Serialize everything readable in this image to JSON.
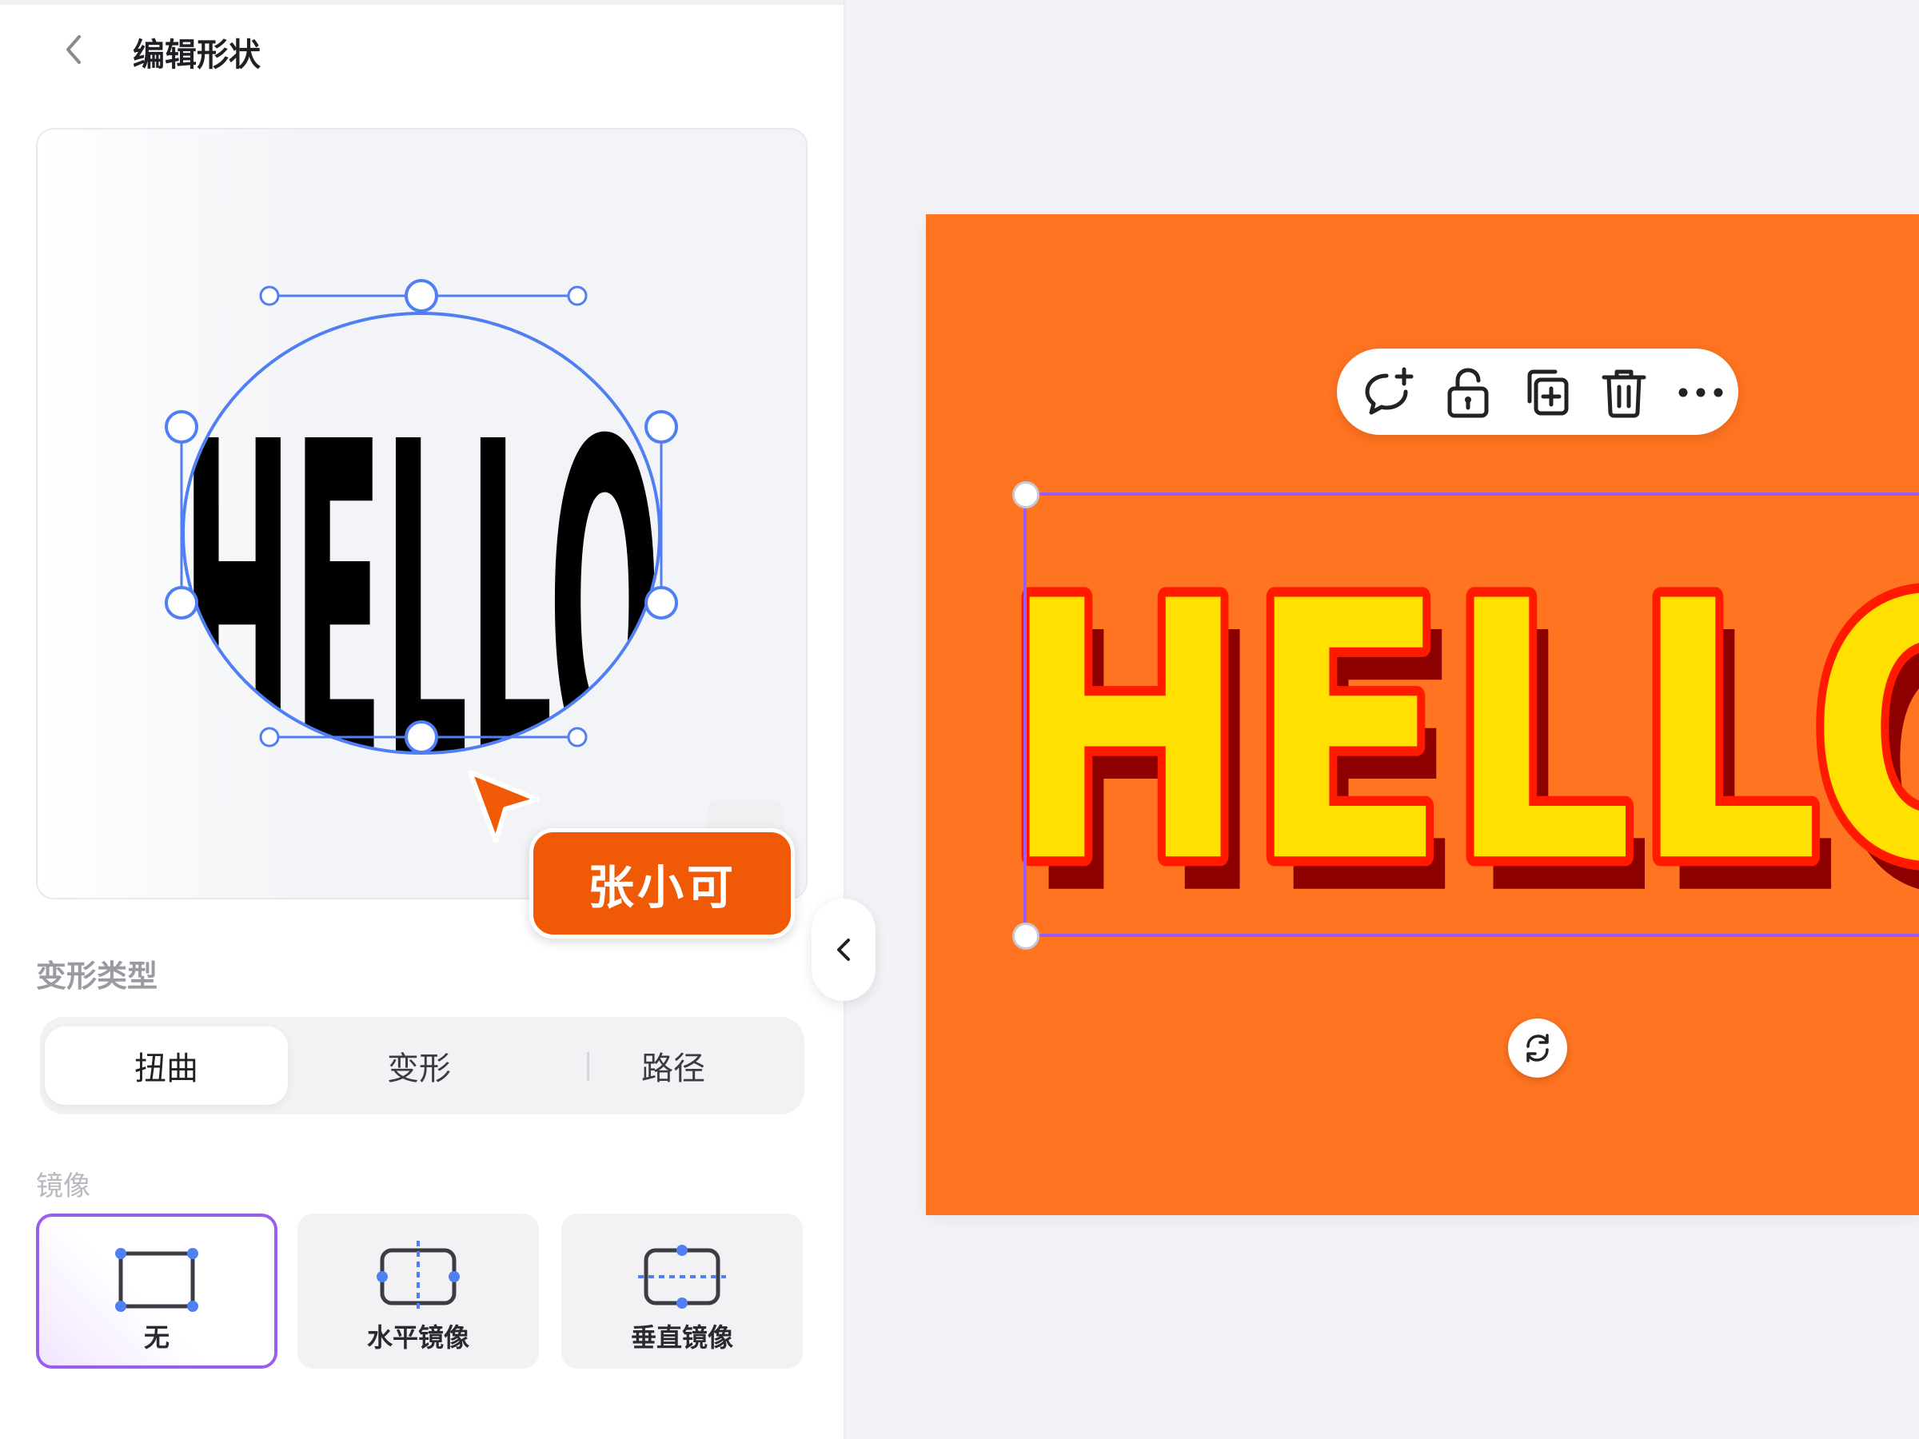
{
  "panel": {
    "title": "编辑形状",
    "back_icon": "chevron-left-icon"
  },
  "preview": {
    "text": "HELLO"
  },
  "warp_type": {
    "label": "变形类型",
    "options": [
      {
        "label": "扭曲",
        "active": true
      },
      {
        "label": "变形",
        "active": false
      },
      {
        "label": "路径",
        "active": false
      }
    ]
  },
  "mirror": {
    "label": "镜像",
    "options": [
      {
        "label": "无",
        "selected": true,
        "icon": "mirror-none-icon"
      },
      {
        "label": "水平镜像",
        "selected": false,
        "icon": "mirror-horizontal-icon"
      },
      {
        "label": "垂直镜像",
        "selected": false,
        "icon": "mirror-vertical-icon"
      }
    ]
  },
  "collaborator": {
    "name": "张小可",
    "color": "#f05a06"
  },
  "canvas": {
    "background": "#ff7420",
    "text": "HELLO",
    "fill_color": "#ffe000",
    "outline_color": "#ff1a00",
    "shadow_color": "#8c0000"
  },
  "toolbar": {
    "icons": [
      "add-comment-icon",
      "unlock-icon",
      "duplicate-icon",
      "delete-icon",
      "more-icon"
    ]
  },
  "colors": {
    "accent": "#4f7ff2",
    "selection": "#9b5cf2"
  }
}
